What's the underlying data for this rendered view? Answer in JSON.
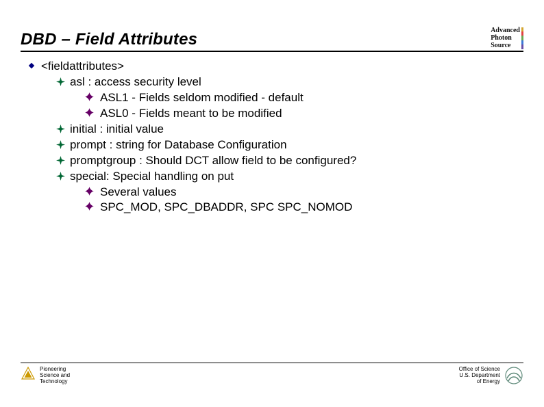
{
  "title": "DBD – Field Attributes",
  "aps_logo": {
    "line1": "Advanced",
    "line2": "Photon",
    "line3": "Source"
  },
  "bullets": {
    "l1_1": "<fieldattributes>",
    "l2_1": "asl : access security level",
    "l3_1": "ASL1 - Fields seldom modified - default",
    "l3_2": "ASL0 - Fields meant to be modified",
    "l2_2": "initial : initial value",
    "l2_3": "prompt : string for Database Configuration",
    "l2_4": "promptgroup : Should DCT allow field to be configured?",
    "l2_5": "special: Special handling on put",
    "l3_3": "Several values",
    "l3_4": "SPC_MOD, SPC_DBADDR, SPC SPC_NOMOD"
  },
  "footer": {
    "left1": "Pioneering",
    "left2": "Science and",
    "left3": "Technology",
    "right1": "Office of Science",
    "right2": "U.S. Department",
    "right3": "of Energy"
  },
  "colors": {
    "bullet_diamond": "#000080",
    "bullet_4pt": "#006633",
    "bullet_cross": "#660066",
    "tri_logo": "#cc9900",
    "oos_logo": "#5f8a7a"
  }
}
